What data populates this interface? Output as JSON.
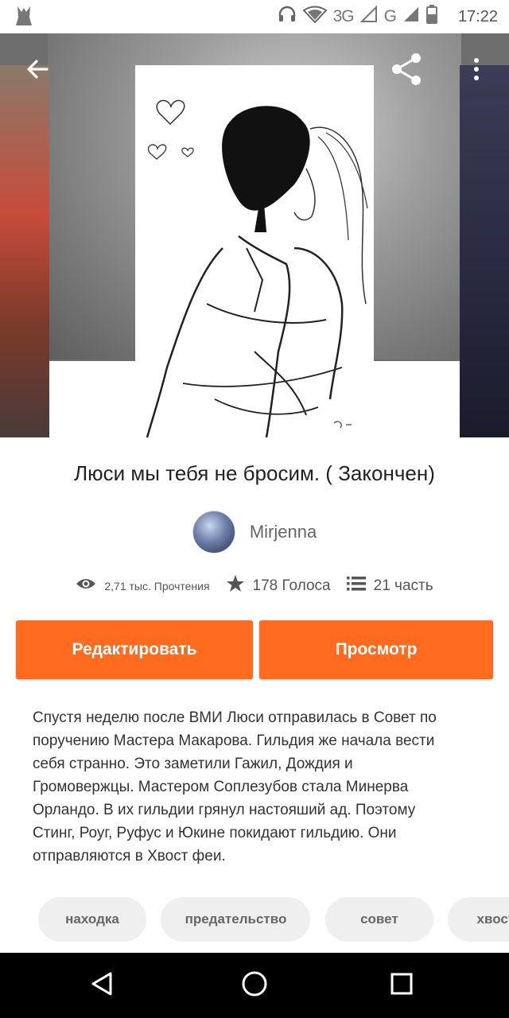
{
  "status_bar": {
    "network_3g": "3G",
    "network_g": "G",
    "time": "17:22",
    "icons": [
      "app-icon",
      "headphones-icon",
      "wifi-icon",
      "signal-icon",
      "signal-icon",
      "battery-icon"
    ]
  },
  "header": {
    "icons": [
      "back-arrow-icon",
      "share-icon",
      "more-vert-icon"
    ]
  },
  "story": {
    "title": "Люси мы тебя не бросим. ( Закончен)",
    "author": "Mirjenna",
    "stats": {
      "reads": "2,71 тыс. Прочтения",
      "votes": "178 Голоса",
      "parts": "21 часть"
    },
    "description": "Спустя неделю после ВМИ Люси отправилась в Совет по поручению Мастера Макарова. Гильдия же начала вести себя странно. Это заметили Гажил, Дождия и Громовержцы. Мастером Соплезубов стала Минерва Орландо. В их гильдии грянул настояший ад. Поэтому Стинг, Роуг, Руфус и Юкине покидают гильдию. Они отправляются в Хвост феи.",
    "tags": [
      "находка",
      "предательство",
      "совет",
      "хвост"
    ]
  },
  "actions": {
    "edit_label": "Редактировать",
    "view_label": "Просмотр"
  },
  "colors": {
    "accent": "#ff6b1f",
    "tag_bg": "#efefef",
    "navbar": "#000000"
  },
  "navigation": {
    "icons": [
      "back-triangle-icon",
      "home-circle-icon",
      "recents-square-icon"
    ]
  }
}
